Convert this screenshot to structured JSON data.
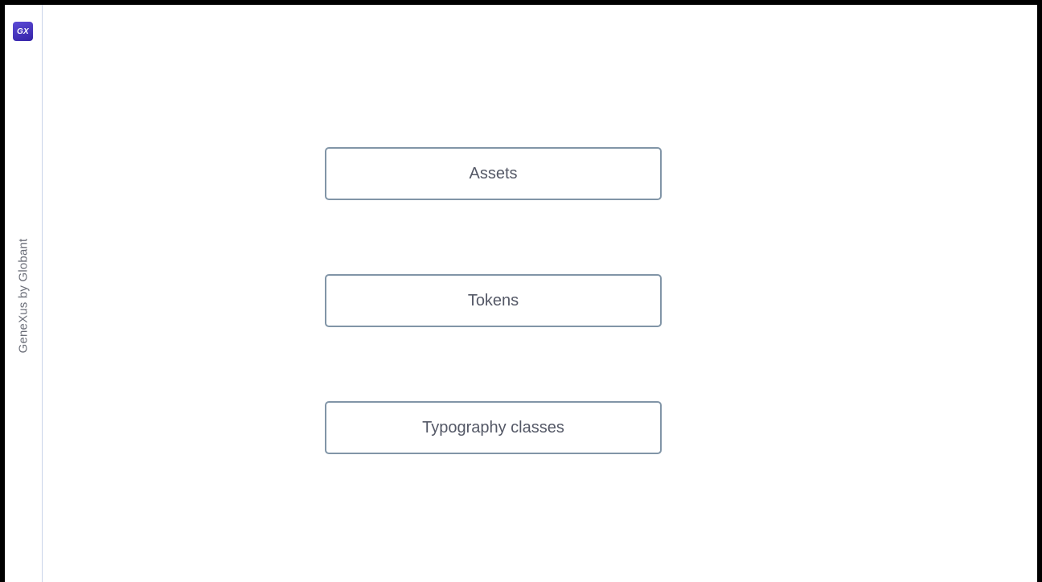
{
  "sidebar": {
    "logo_text": "GX",
    "brand_text": "GeneXus by Globant",
    "accent_color": "#3f2fb8"
  },
  "main": {
    "buttons": [
      {
        "label": "Assets"
      },
      {
        "label": "Tokens"
      },
      {
        "label": "Typography classes"
      }
    ],
    "border_color": "#8195a7"
  }
}
